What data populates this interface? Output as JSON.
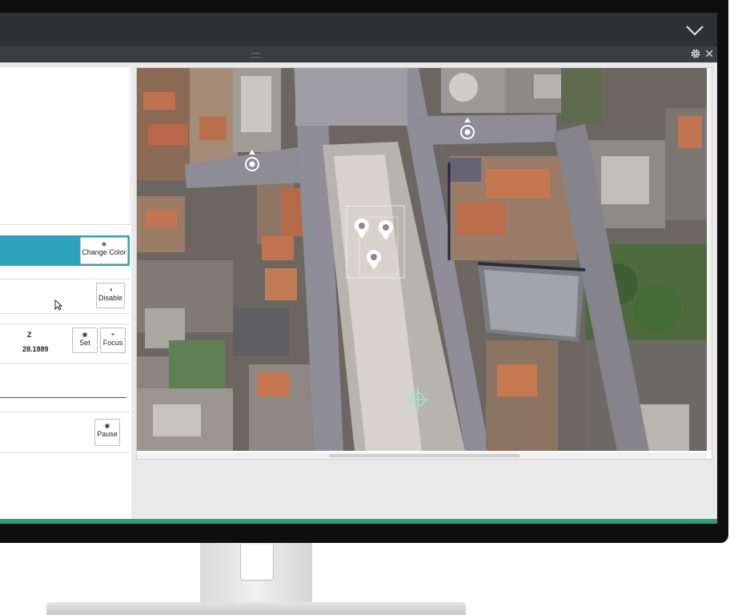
{
  "toolbar": {
    "collapse_icon": "chevron-down-icon",
    "settings_icon": "gear-icon",
    "close_icon": "close-icon",
    "close_glyph": "✕"
  },
  "left_panel": {
    "change_color": {
      "label": "Change Color",
      "icon": "color-fill-icon"
    },
    "disable": {
      "label": "Disable",
      "icon": "toggle-icon"
    },
    "position": {
      "z_header": "Z",
      "z_value": "28.1889",
      "set_label": "Set",
      "focus_label": "Focus"
    },
    "pause": {
      "label": "Pause",
      "icon": "pause-icon"
    }
  },
  "map": {
    "markers": [
      "pin",
      "pin",
      "pin",
      "pin",
      "pin"
    ],
    "crosshair_icon": "crosshair-icon"
  },
  "colors": {
    "accent": "#2ea3be",
    "status_bar": "#27a37f",
    "titlebar": "#2f3032"
  }
}
